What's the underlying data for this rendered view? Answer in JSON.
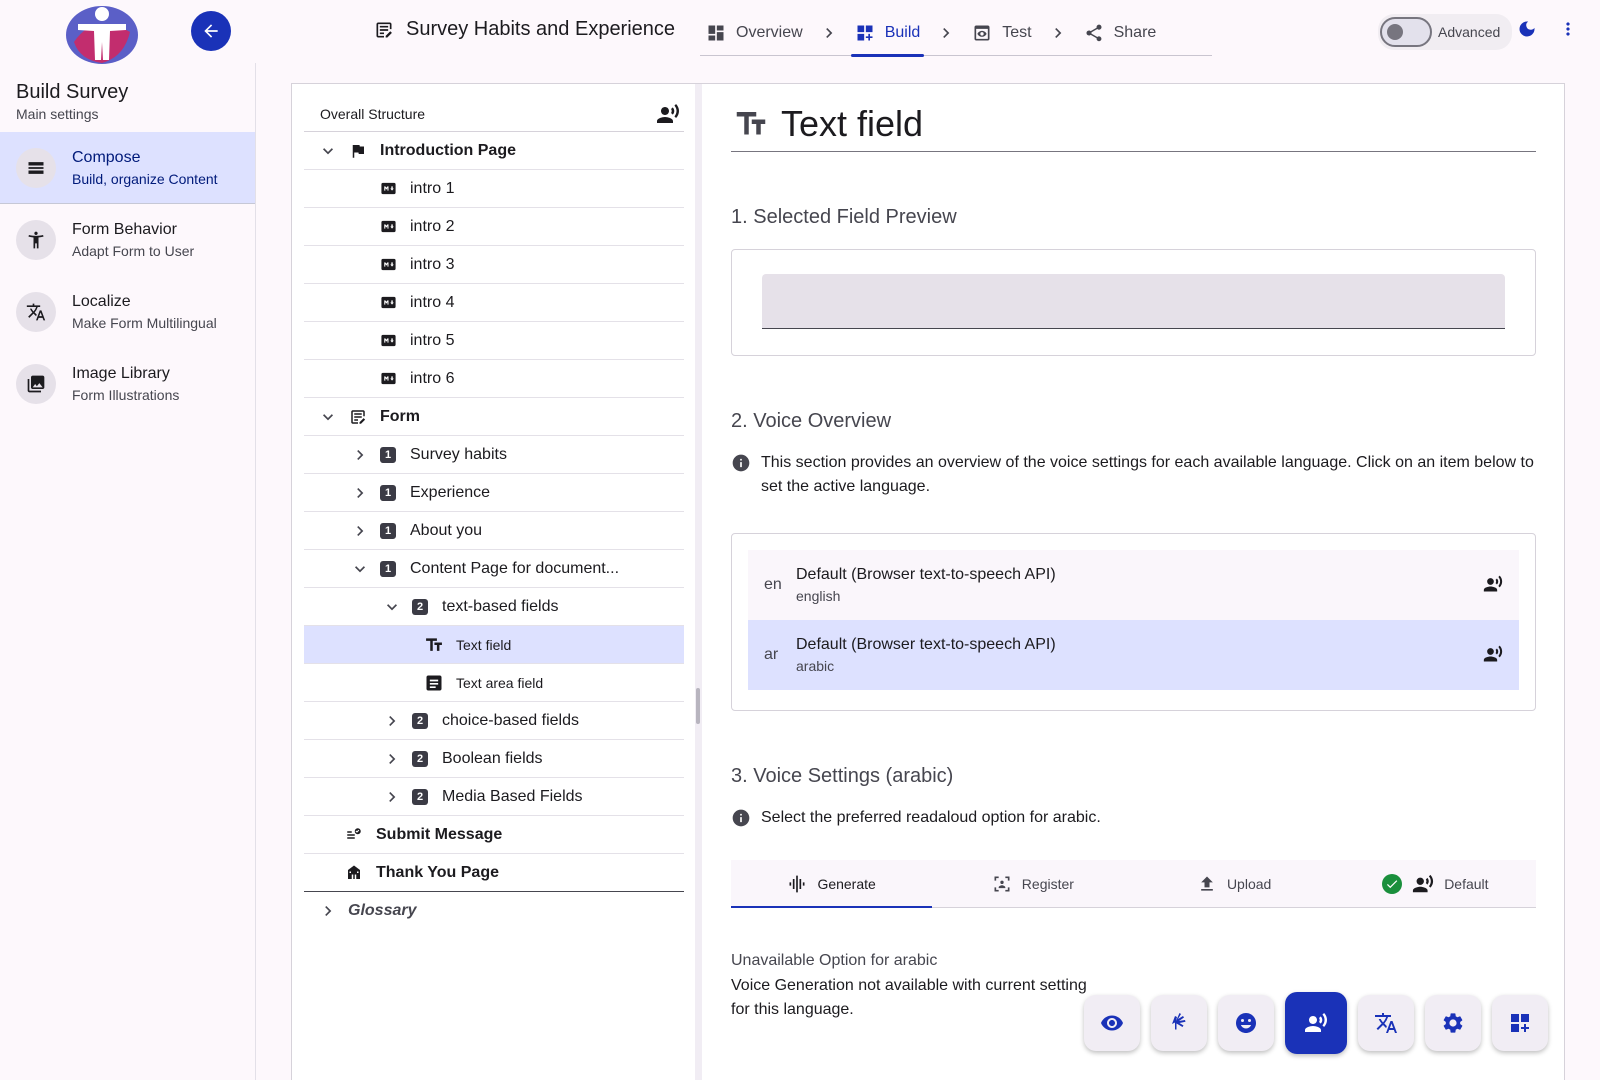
{
  "header": {
    "form_title": "Survey Habits and Experience",
    "steps": [
      {
        "label": "Overview"
      },
      {
        "label": "Build"
      },
      {
        "label": "Test"
      },
      {
        "label": "Share"
      }
    ],
    "active_step": "Build",
    "advanced_label": "Advanced",
    "advanced_enabled": false,
    "accent_color": "#1a32b8"
  },
  "sidebar": {
    "title": "Build Survey",
    "subtitle": "Main settings",
    "items": [
      {
        "label": "Compose",
        "desc": "Build, organize Content",
        "icon": "compose-icon",
        "active": true
      },
      {
        "label": "Form Behavior",
        "desc": "Adapt Form to User",
        "icon": "accessibility-icon",
        "active": false
      },
      {
        "label": "Localize",
        "desc": "Make Form Multilingual",
        "icon": "translate-icon",
        "active": false
      },
      {
        "label": "Image Library",
        "desc": "Form Illustrations",
        "icon": "image-icon",
        "active": false
      }
    ]
  },
  "tree": {
    "header": "Overall Structure",
    "intro_page": "Introduction Page",
    "intros": [
      "intro 1",
      "intro 2",
      "intro 3",
      "intro 4",
      "intro 5",
      "intro 6"
    ],
    "form": "Form",
    "pages": [
      "Survey habits",
      "Experience",
      "About you",
      "Content Page for document..."
    ],
    "page_badge": "1",
    "section_badge": "2",
    "sections": [
      "text-based fields",
      "choice-based fields",
      "Boolean fields",
      "Media Based Fields"
    ],
    "fields": [
      "Text field",
      "Text area field"
    ],
    "submit": "Submit Message",
    "thank_you": "Thank You Page",
    "glossary": "Glossary"
  },
  "content": {
    "field_title": "Text field",
    "section1": "1. Selected Field Preview",
    "section2": "2. Voice Overview",
    "voice_info": "This section provides an overview of the voice settings for each available language. Click on an item below to set the active language.",
    "voices": [
      {
        "code": "en",
        "label": "Default (Browser text-to-speech API)",
        "lang": "english",
        "selected": false
      },
      {
        "code": "ar",
        "label": "Default (Browser text-to-speech API)",
        "lang": "arabic",
        "selected": true
      }
    ],
    "section3": "3. Voice Settings (arabic)",
    "settings_info": "Select the preferred readaloud option for arabic.",
    "tabs": [
      "Generate",
      "Register",
      "Upload",
      "Default"
    ],
    "active_tab": "Generate",
    "unavailable_title": "Unavailable Option for arabic",
    "unavailable_text": "Voice Generation not available with current setting for this language."
  },
  "fab_toolbar": [
    "preview-icon",
    "sign-language-icon",
    "emoji-icon",
    "voice-icon",
    "translate-icon",
    "settings-icon",
    "add-widget-icon"
  ],
  "fab_active": "voice-icon"
}
